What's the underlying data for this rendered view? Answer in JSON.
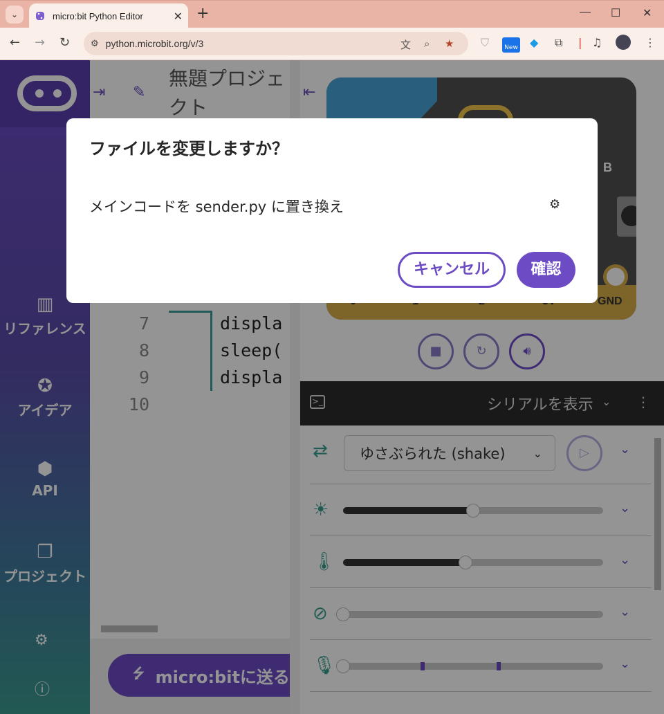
{
  "browser": {
    "tab_title": "micro:bit Python Editor",
    "url": "python.microbit.org/v/3",
    "new_badge": "New",
    "window_controls": {
      "minimize": "—",
      "maximize": "☐",
      "close": "✕"
    }
  },
  "sidebar": {
    "items": [
      {
        "icon": "library-icon",
        "label": "リファレンス"
      },
      {
        "icon": "lightbulb-icon",
        "label": "アイデア"
      },
      {
        "icon": "python-icon",
        "label": "API"
      },
      {
        "icon": "documents-icon",
        "label": "プロジェクト"
      }
    ]
  },
  "editor": {
    "project_title": "無題プロジェクト",
    "lines": [
      {
        "no": "7",
        "code": "displa"
      },
      {
        "no": "8",
        "code": "sleep("
      },
      {
        "no": "9",
        "code": "displa"
      },
      {
        "no": "10",
        "code": ""
      }
    ],
    "send_button": "micro:bitに送る"
  },
  "simulator": {
    "pins": [
      "0",
      "1",
      "2",
      "3V",
      "GND"
    ],
    "button_b_label": "B",
    "serial_label": "シリアルを表示",
    "gesture_value": "ゆさぶられた (shake)",
    "sensors": {
      "light_level": 0.5,
      "temperature_level": 0.47,
      "compass_level": 0.0,
      "sound_level": 0.0
    }
  },
  "dialog": {
    "title": "ファイルを変更しますか？",
    "message": "メインコードを sender.py に置き換え",
    "cancel": "キャンセル",
    "confirm": "確認"
  },
  "colors": {
    "accent": "#6c4bc4",
    "teal": "#3a9d8f",
    "board_gold": "#d8ad45"
  }
}
